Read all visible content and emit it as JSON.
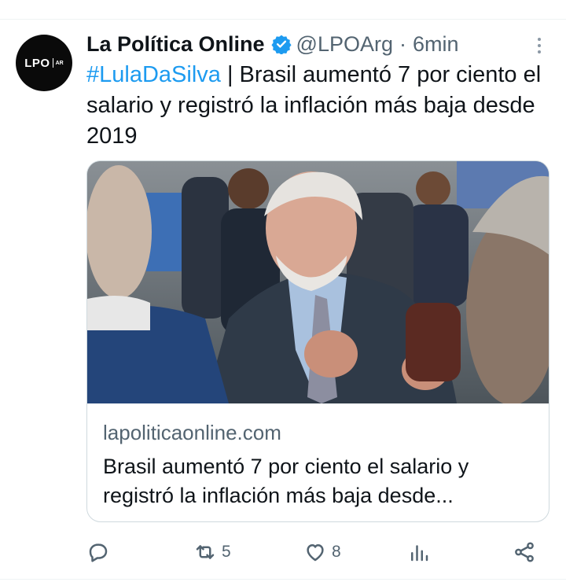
{
  "tweet": {
    "author_name": "La Política Online",
    "handle": "@LPOArg",
    "separator": "·",
    "time": "6min",
    "avatar_text": "LPO",
    "avatar_subtext": "AR",
    "hashtag": "#LulaDaSilva",
    "text": " | Brasil aumentó 7 por ciento el salario y registró la inflación más baja desde 2019"
  },
  "card": {
    "domain": "lapoliticaonline.com",
    "title": "Brasil aumentó 7 por ciento el salario y registró la inflación más baja desde..."
  },
  "actions": {
    "reply_count": "",
    "retweet_count": "5",
    "like_count": "8",
    "views_count": ""
  },
  "colors": {
    "accent": "#1d9bf0",
    "text": "#0f1419",
    "secondary": "#536471",
    "border": "#cfd9de"
  },
  "icons": [
    "verified-badge-icon",
    "more-icon",
    "reply-icon",
    "retweet-icon",
    "like-icon",
    "views-icon",
    "share-icon"
  ]
}
